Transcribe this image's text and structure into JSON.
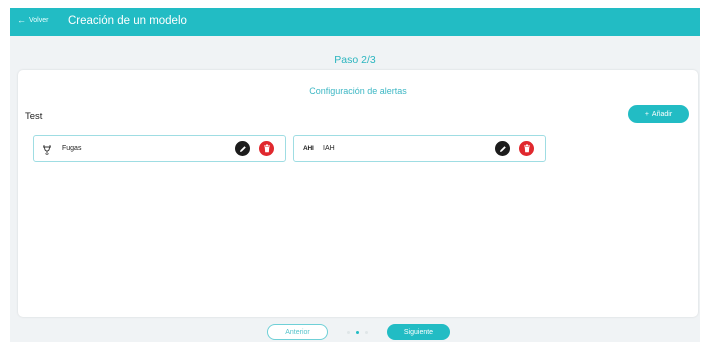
{
  "header": {
    "back_label": "Volver",
    "title": "Creación de un modelo"
  },
  "step_label": "Paso 2/3",
  "panel": {
    "section_title": "Configuración de alertas",
    "group_name": "Test",
    "add_label": "Añadir",
    "cards": [
      {
        "name": "Fugas",
        "icon": "leak-icon"
      },
      {
        "name": "IAH",
        "icon": "ahi-icon",
        "icon_text": "AHI"
      }
    ]
  },
  "footer": {
    "prev_label": "Anterior",
    "next_label": "Siguiente",
    "pagination": {
      "total": 3,
      "current": 2
    }
  },
  "colors": {
    "accent": "#22bcc4",
    "delete": "#e0282e",
    "edit": "#1c1c1c"
  }
}
